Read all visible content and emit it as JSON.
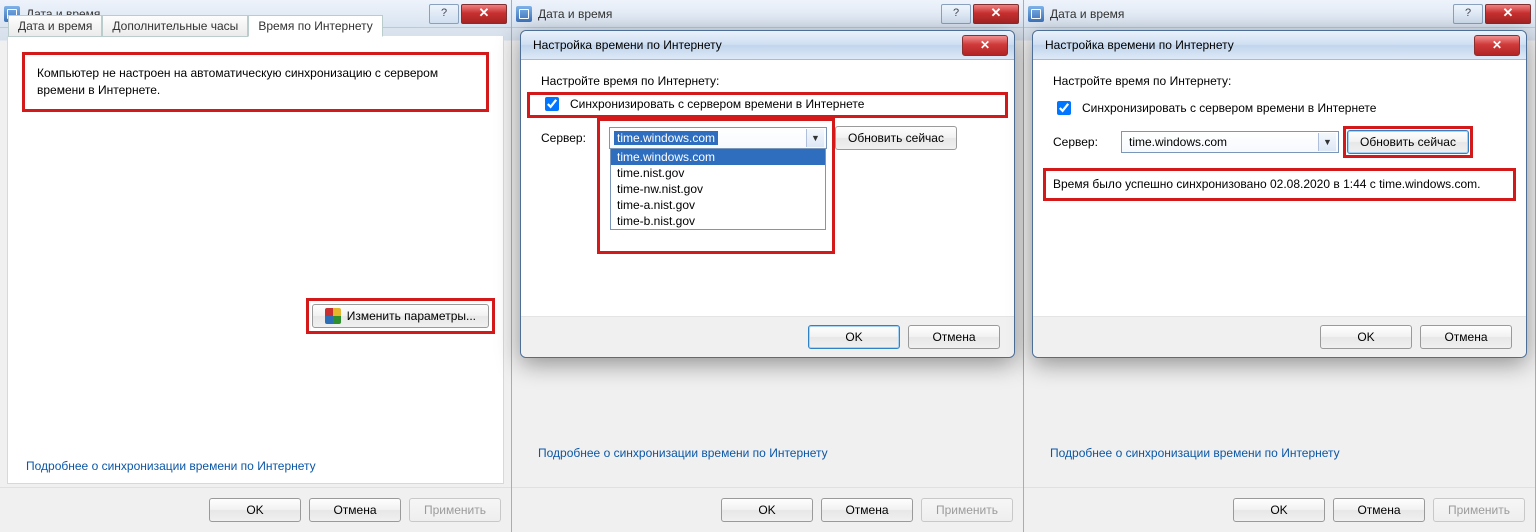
{
  "parent": {
    "title": "Дата и время",
    "tabs": [
      "Дата и время",
      "Дополнительные часы",
      "Время по Интернету"
    ],
    "message": "Компьютер не настроен на автоматическую синхронизацию с сервером времени в Интернете.",
    "change_button": "Изменить параметры...",
    "link": "Подробнее о синхронизации времени по Интернету",
    "ok": "OK",
    "cancel": "Отмена",
    "apply": "Применить"
  },
  "modal": {
    "title": "Настройка времени по Интернету",
    "intro": "Настройте время по Интернету:",
    "checkbox": "Синхронизировать с сервером времени в Интернете",
    "server_label": "Сервер:",
    "server_value": "time.windows.com",
    "options": [
      "time.windows.com",
      "time.nist.gov",
      "time-nw.nist.gov",
      "time-a.nist.gov",
      "time-b.nist.gov"
    ],
    "update": "Обновить сейчас",
    "ok": "OK",
    "cancel": "Отмена"
  },
  "modal3": {
    "status": "Время было успешно синхронизовано 02.08.2020 в 1:44 с time.windows.com."
  }
}
